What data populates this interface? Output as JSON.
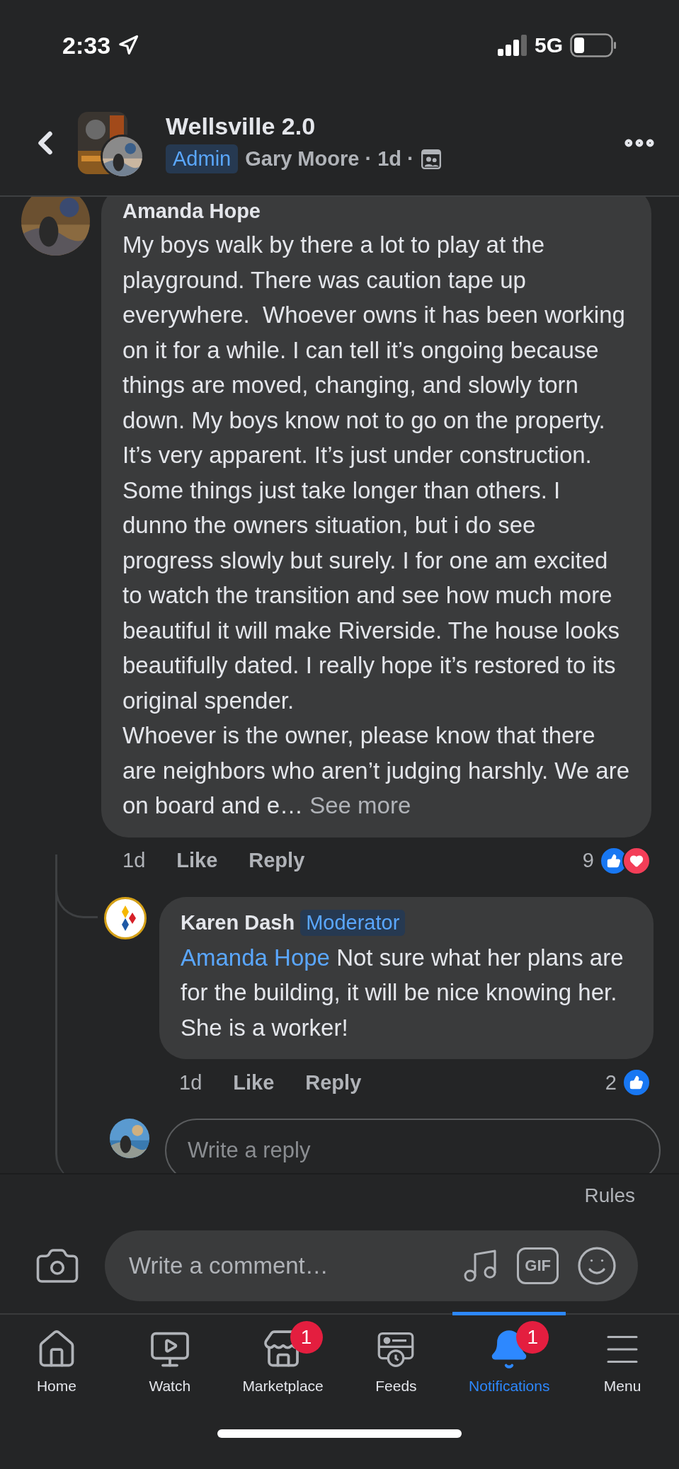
{
  "status_bar": {
    "time": "2:33",
    "network": "5G"
  },
  "header": {
    "group_name": "Wellsville 2.0",
    "badge": "Admin",
    "meta": "Gary Moore · 1d ·"
  },
  "comments": [
    {
      "author": "Amanda Hope",
      "text": "My boys walk by there a lot to play at the playground. There was caution tape up everywhere.  Whoever owns it has been working on it for a while. I can tell it’s ongoing because things are moved, changing, and slowly torn down. My boys know not to go on the property. It’s very apparent. It’s just under construction. Some things just take longer than others. I dunno the owners situation, but i do see progress slowly but surely. I for one am excited to watch the transition and see how much more beautiful it will make Riverside. The house looks beautifully dated. I really hope it’s restored to its original spender.\nWhoever is the owner, please know that there are neighbors who aren’t judging harshly. We are on board and e…",
      "see_more": "See more",
      "time": "1d",
      "actions": [
        "Like",
        "Reply"
      ],
      "reaction_count": "9",
      "reactions": [
        {
          "kind": "like"
        },
        {
          "kind": "love"
        }
      ],
      "replies": [
        {
          "author": "Karen Dash",
          "badge": "Moderator",
          "mention": "Amanda Hope",
          "text": "Not sure what her plans are for the building, it will be nice knowing her. She is a worker!",
          "time": "1d",
          "actions": [
            "Like",
            "Reply"
          ],
          "reaction_count": "2",
          "reactions": [
            {
              "kind": "like"
            }
          ]
        }
      ],
      "reply_field": {
        "placeholder": "Write a reply"
      }
    }
  ],
  "composer": {
    "rules": "Rules",
    "placeholder": "Write a comment…",
    "gif": "GIF"
  },
  "tabs": [
    {
      "label": "Home",
      "kind": "home",
      "selected": false
    },
    {
      "label": "Watch",
      "kind": "watch",
      "selected": false
    },
    {
      "label": "Marketplace",
      "kind": "marketplace",
      "selected": false,
      "badge": "1"
    },
    {
      "label": "Feeds",
      "kind": "feeds",
      "selected": false
    },
    {
      "label": "Notifications",
      "kind": "bell",
      "selected": true,
      "badge": "1"
    },
    {
      "label": "Menu",
      "kind": "menu",
      "selected": false
    }
  ]
}
